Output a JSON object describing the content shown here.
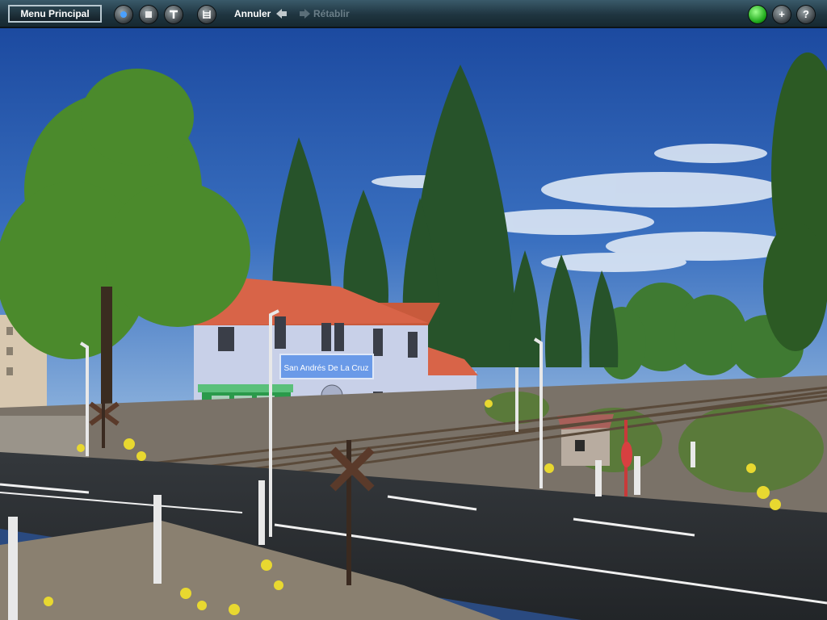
{
  "toolbar": {
    "menu_label": "Menu Principal",
    "undo_label": "Annuler",
    "redo_label": "Rétablir",
    "help_glyph": "?",
    "add_glyph": "+"
  },
  "icons": [
    "play-icon",
    "stop-icon",
    "signal-icon",
    "rail-icon",
    "back-arrow-icon",
    "forward-arrow-icon",
    "status-light-icon",
    "add-icon",
    "help-icon"
  ],
  "scene": {
    "station_sign": "San Andrés De La Cruz"
  },
  "colors": {
    "toolbar_bg": "#1f3540",
    "status_green": "#1ea81a",
    "sky": "#2a5aa8"
  }
}
